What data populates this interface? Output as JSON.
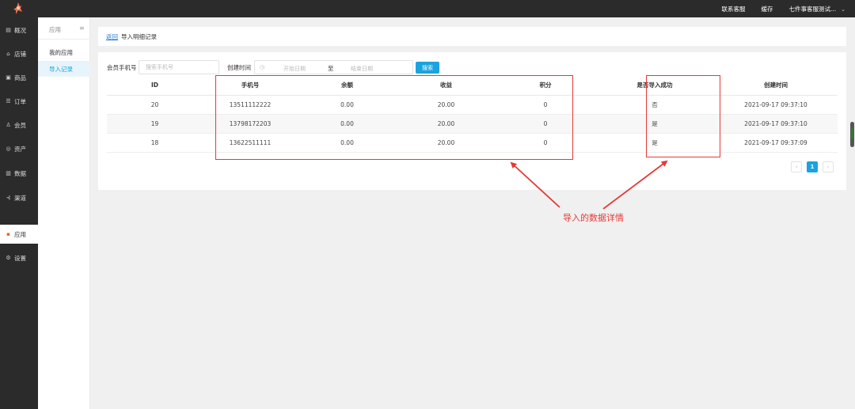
{
  "topbar": {
    "links": [
      "联系客服",
      "缓存",
      "七件事客服测试..."
    ],
    "chevron_icon": "chevron-down-icon"
  },
  "sidebar": {
    "items": [
      {
        "label": "概况",
        "icon": "overview-icon",
        "glyph": "▤"
      },
      {
        "label": "店铺",
        "icon": "shop-icon",
        "glyph": "⌂"
      },
      {
        "label": "商品",
        "icon": "goods-icon",
        "glyph": "▣"
      },
      {
        "label": "订单",
        "icon": "order-icon",
        "glyph": "☰"
      },
      {
        "label": "会员",
        "icon": "member-icon",
        "glyph": "♙"
      },
      {
        "label": "资产",
        "icon": "asset-icon",
        "glyph": "◎"
      },
      {
        "label": "数据",
        "icon": "data-icon",
        "glyph": "▥"
      },
      {
        "label": "渠道",
        "icon": "channel-icon",
        "glyph": "⊰"
      },
      {
        "label": "应用",
        "icon": "apps-icon",
        "glyph": "▪",
        "active": true
      },
      {
        "label": "设置",
        "icon": "settings-icon",
        "glyph": "⚙"
      }
    ]
  },
  "subnav": {
    "title": "应用",
    "toggle": "≡",
    "items": [
      "我的应用",
      "导入记录"
    ],
    "active_index": 1
  },
  "breadcrumb": {
    "back": "返回",
    "title": "导入明细记录"
  },
  "filter": {
    "phone_label": "会员手机号",
    "phone_placeholder": "搜索手机号",
    "time_label": "创建时间",
    "start_placeholder": "开始日期",
    "separator": "至",
    "end_placeholder": "结束日期",
    "search_button": "搜索"
  },
  "table": {
    "columns": [
      "ID",
      "手机号",
      "余额",
      "收益",
      "积分",
      "是否导入成功",
      "创建时间"
    ],
    "rows": [
      [
        "20",
        "13511112222",
        "0.00",
        "20.00",
        "0",
        "否",
        "2021-09-17 09:37:10"
      ],
      [
        "19",
        "13798172203",
        "0.00",
        "20.00",
        "0",
        "是",
        "2021-09-17 09:37:10"
      ],
      [
        "18",
        "13622511111",
        "0.00",
        "20.00",
        "0",
        "是",
        "2021-09-17 09:37:09"
      ]
    ]
  },
  "pagination": {
    "prev": "‹",
    "current": "1",
    "next": "›"
  },
  "annotation": {
    "note": "导入的数据详情",
    "color": "#e53935"
  },
  "colors": {
    "accent": "#1aa3e0",
    "sidebar_bg": "#2b2b2b",
    "annotation": "#e53935"
  }
}
